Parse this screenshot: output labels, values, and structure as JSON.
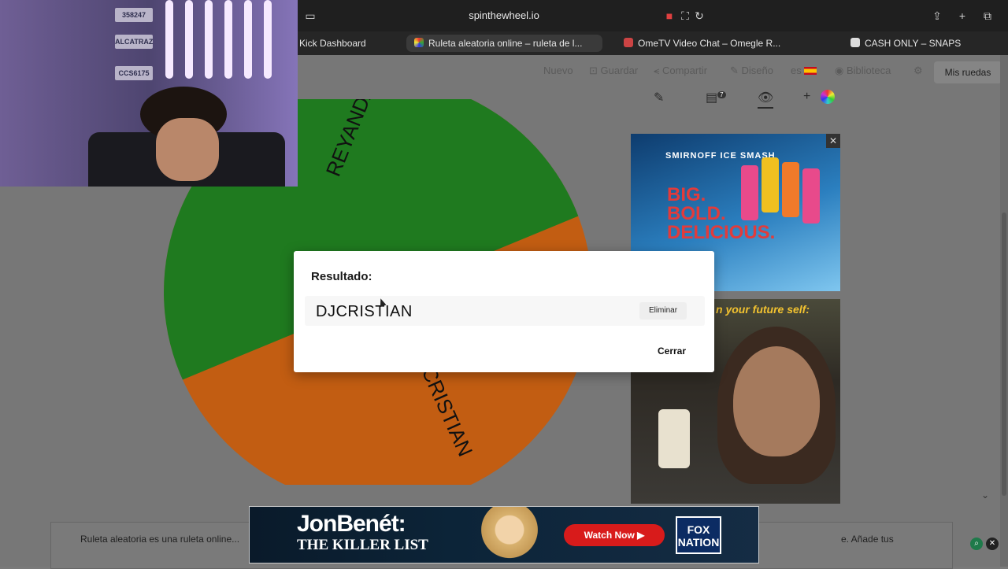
{
  "browser": {
    "url": "spinthewheel.io",
    "tabs": [
      {
        "label": "Kick Dashboard"
      },
      {
        "label": "Ruleta aleatoria online – ruleta de l..."
      },
      {
        "label": "OmeTV Video Chat – Omegle R..."
      },
      {
        "label": "CASH ONLY – SNAPS"
      }
    ]
  },
  "nav": {
    "nuevo": "Nuevo",
    "guardar": "Guardar",
    "compartir": "Compartir",
    "diseno": "Diseño",
    "lang": "es",
    "biblioteca": "Biblioteca",
    "mis_ruedas": "Mis ruedas"
  },
  "toolbar": {
    "badge": "7",
    "plus": "+"
  },
  "wheel": {
    "segments": [
      {
        "label": "DJREYANDALEX",
        "color": "#1f7a1f"
      },
      {
        "label": "DJCRISTIAN",
        "color": "#c25d12"
      }
    ],
    "visible_labels": [
      "REYANDALEX",
      "CRISTIAN"
    ]
  },
  "ads": {
    "smirnoff_brand": "SMIRNOFF ICE SMASH",
    "smirnoff_title": "BIG. BOLD. DELICIOUS.",
    "ad2_text": "n your future self:"
  },
  "banner": {
    "title": "JonBenét:",
    "subtitle": "THE KILLER LIST",
    "button": "Watch Now",
    "brand": "FOX NATION"
  },
  "footer": {
    "text_left": "Ruleta aleatoria es una ruleta online...",
    "text_right": "e. Añade tus"
  },
  "modal": {
    "title": "Resultado:",
    "result": "DJCRISTIAN",
    "delete_label": "Eliminar",
    "close_label": "Cerrar"
  },
  "webcam": {
    "plates": [
      "358247",
      "ALCATRAZ",
      "CCS6175"
    ]
  },
  "colors": {
    "green": "#1f7a1f",
    "orange": "#c25d12",
    "accent_red": "#d81b1b"
  }
}
